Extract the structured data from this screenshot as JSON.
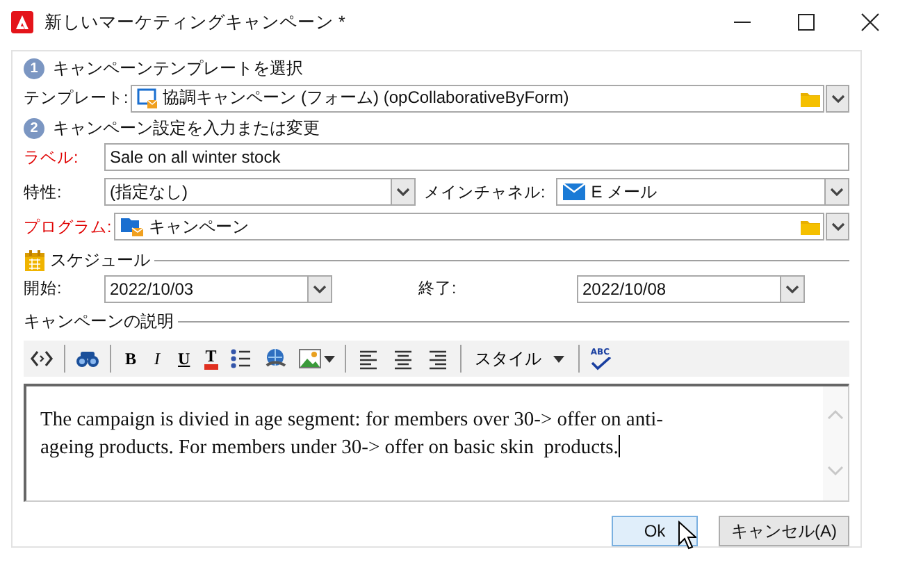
{
  "window": {
    "title": "新しいマーケティングキャンペーン *"
  },
  "template_step": {
    "number": "1",
    "title": "キャンペーンテンプレートを選択",
    "field": {
      "label": "テンプレート:",
      "required": false,
      "value": "協調キャンペーン (フォーム) (opCollaborativeByForm)"
    }
  },
  "settings_step": {
    "number": "2",
    "title": "キャンペーン設定を入力または変更",
    "label_field": {
      "label": "ラベル:",
      "required": true,
      "value": "Sale on all winter stock"
    },
    "nature": {
      "label": "特性:",
      "required": false,
      "value": "(指定なし)"
    },
    "channel": {
      "label": "メインチャネル:",
      "required": false,
      "value": "E メール"
    },
    "program": {
      "label": "プログラム:",
      "required": true,
      "value": "キャンペーン"
    }
  },
  "schedule": {
    "title": "スケジュール",
    "start": {
      "label": "開始:",
      "value": "2022/10/03"
    },
    "end": {
      "label": "終了:",
      "value": "2022/10/08"
    }
  },
  "description": {
    "title": "キャンペーンの説明",
    "toolbar": [
      {
        "kind": "code"
      },
      {
        "kind": "sep"
      },
      {
        "kind": "find"
      },
      {
        "kind": "sep"
      },
      {
        "kind": "bold",
        "label": "B"
      },
      {
        "kind": "italic",
        "label": "I"
      },
      {
        "kind": "underline",
        "label": "U"
      },
      {
        "kind": "color",
        "label": "T"
      },
      {
        "kind": "list"
      },
      {
        "kind": "link"
      },
      {
        "kind": "image"
      },
      {
        "kind": "sep"
      },
      {
        "kind": "align-left"
      },
      {
        "kind": "align-center"
      },
      {
        "kind": "align-right"
      },
      {
        "kind": "sep"
      },
      {
        "kind": "style",
        "label": "スタイル"
      },
      {
        "kind": "sep"
      },
      {
        "kind": "spell",
        "label": "ABC"
      }
    ],
    "text": "The campaign is divied in age segment: for members over 30-> offer on anti-ageing products. For members under 30-> offer on basic skin  products."
  },
  "buttons": [
    {
      "label": "Ok",
      "kind": "default"
    },
    {
      "label": "キャンセル(A)",
      "kind": "normal"
    }
  ]
}
